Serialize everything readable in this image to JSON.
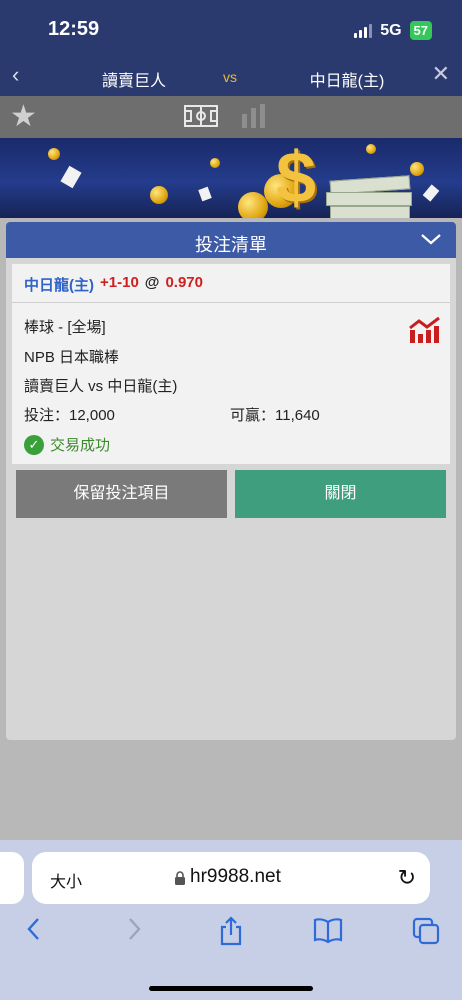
{
  "status_bar": {
    "time": "12:59",
    "network": "5G",
    "battery": "57"
  },
  "header": {
    "back_icon": "‹",
    "home_team": "讀賣巨人",
    "vs": "vs",
    "away_team": "中日龍(主)",
    "close_icon": "✕"
  },
  "icon_row": {
    "favorite_icon": "star-icon",
    "field_icon": "field-icon",
    "stats_icon": "bar-chart-icon"
  },
  "panel": {
    "title": "投注清單",
    "bet": {
      "team": "中日龍(主)",
      "handicap": "+1-10",
      "at": "@",
      "odds": "0.970",
      "sport": "棒球 - [全場]",
      "league": "NPB 日本職棒",
      "match": "讀賣巨人 vs 中日龍(主)",
      "stake": "投注：12,000",
      "to_win": "可贏：11,640",
      "status": "交易成功"
    },
    "buttons": {
      "keep": "保留投注項目",
      "close": "關閉"
    }
  },
  "browser": {
    "text_size": "大小",
    "domain": "hr9988.net"
  },
  "colors": {
    "navy": "#2b3a6e",
    "panel_head": "#3d5aa6",
    "success": "#3a8a2a",
    "close_btn": "#3f9e7d",
    "keep_btn": "#7a7a7a",
    "accent_red": "#d01f1f",
    "team_blue": "#2f63c8"
  }
}
